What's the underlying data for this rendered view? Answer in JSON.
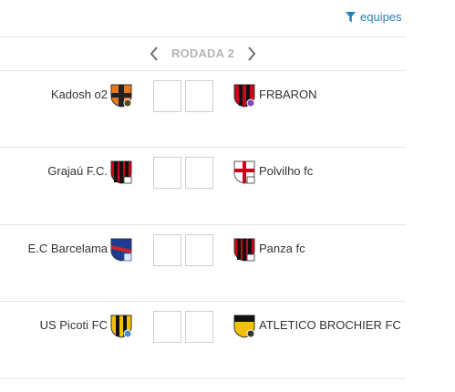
{
  "header": {
    "filter_label": "equipes",
    "filter_icon": "filter-icon"
  },
  "round": {
    "label": "RODADA 2",
    "prev_icon": "chevron-left-icon",
    "next_icon": "chevron-right-icon"
  },
  "colors": {
    "link": "#2a7fb4",
    "round_label": "#b5b5b5",
    "divider": "#e6e6e6"
  },
  "matches": [
    {
      "home": "Kadosh o2",
      "away": "FRBARON",
      "home_score": "",
      "away_score": ""
    },
    {
      "home": "Grajaú F.C.",
      "away": "Polvilho fc",
      "home_score": "",
      "away_score": ""
    },
    {
      "home": "E.C Barcelama",
      "away": "Panza fc",
      "home_score": "",
      "away_score": ""
    },
    {
      "home": "US Picoti FC",
      "away": "ATLETICO BROCHIER FC",
      "home_score": "",
      "away_score": ""
    }
  ]
}
